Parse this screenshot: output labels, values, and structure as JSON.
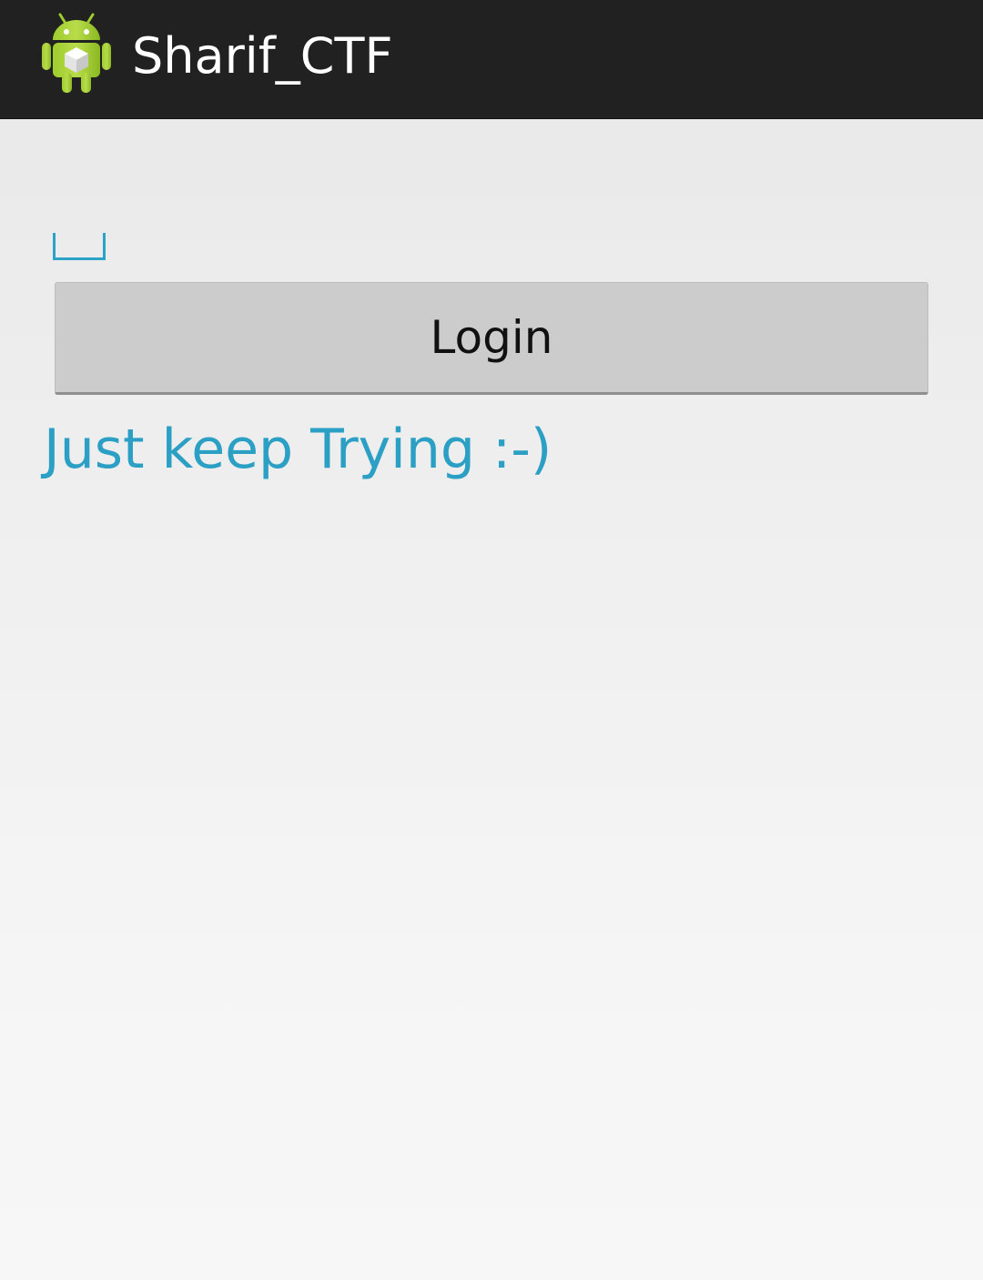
{
  "action_bar": {
    "title": "Sharif_CTF",
    "icon": "android-robot-icon",
    "background": "#212121"
  },
  "login_form": {
    "input_value": "",
    "login_label": "Login",
    "status_message": "Just keep Trying :-)"
  },
  "colors": {
    "accent": "#2ba0c4",
    "button_background": "#cccccc"
  }
}
